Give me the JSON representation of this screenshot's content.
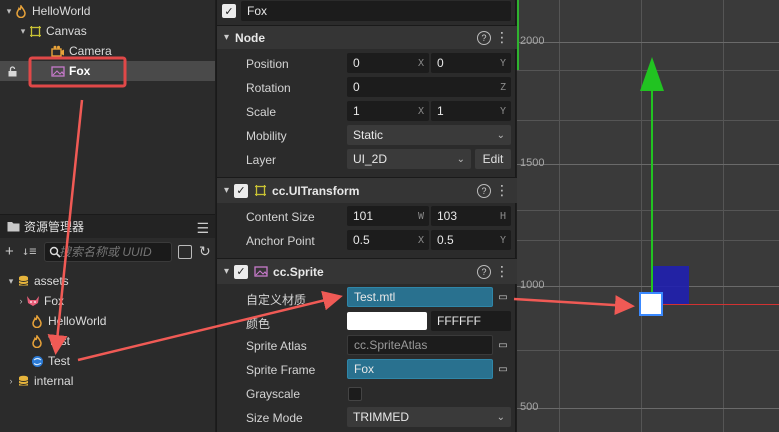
{
  "hierarchy": {
    "items": [
      {
        "label": "HelloWorld"
      },
      {
        "label": "Canvas"
      },
      {
        "label": "Camera"
      },
      {
        "label": "Fox"
      }
    ]
  },
  "assets": {
    "title": "资源管理器",
    "search_placeholder": "搜索名称或 UUID",
    "items": [
      {
        "label": "assets"
      },
      {
        "label": "Fox"
      },
      {
        "label": "HelloWorld"
      },
      {
        "label": "Test"
      },
      {
        "label": "Test"
      },
      {
        "label": "internal"
      }
    ]
  },
  "inspector": {
    "node_name": "Fox",
    "node_section": {
      "title": "Node",
      "position_label": "Position",
      "position_x": "0",
      "position_y": "0",
      "rotation_label": "Rotation",
      "rotation_z": "0",
      "scale_label": "Scale",
      "scale_x": "1",
      "scale_y": "1",
      "mobility_label": "Mobility",
      "mobility_value": "Static",
      "layer_label": "Layer",
      "layer_value": "UI_2D",
      "edit_label": "Edit"
    },
    "uitransform_section": {
      "title": "cc.UITransform",
      "content_size_label": "Content Size",
      "width": "101",
      "height": "103",
      "anchor_label": "Anchor Point",
      "anchor_x": "0.5",
      "anchor_y": "0.5"
    },
    "sprite_section": {
      "title": "cc.Sprite",
      "material_label": "自定义材质",
      "material_value": "Test.mtl",
      "color_label": "颜色",
      "color_hex": "FFFFFF",
      "atlas_label": "Sprite Atlas",
      "atlas_value": "cc.SpriteAtlas",
      "frame_label": "Sprite Frame",
      "frame_value": "Fox",
      "grayscale_label": "Grayscale",
      "size_mode_label": "Size Mode",
      "size_mode_value": "TRIMMED"
    },
    "units": {
      "x": "X",
      "y": "Y",
      "z": "Z",
      "w": "W",
      "h": "H"
    }
  },
  "scene": {
    "y_labels": [
      "2000",
      "1500",
      "1000",
      "500"
    ]
  },
  "colors": {
    "annotation": "#f05a55",
    "selection_box": "#e04848",
    "asset_field": "#29718f",
    "gizmo_y": "#21c321",
    "gizmo_x": "#d23232",
    "sprite_rect": "#2020b0"
  }
}
